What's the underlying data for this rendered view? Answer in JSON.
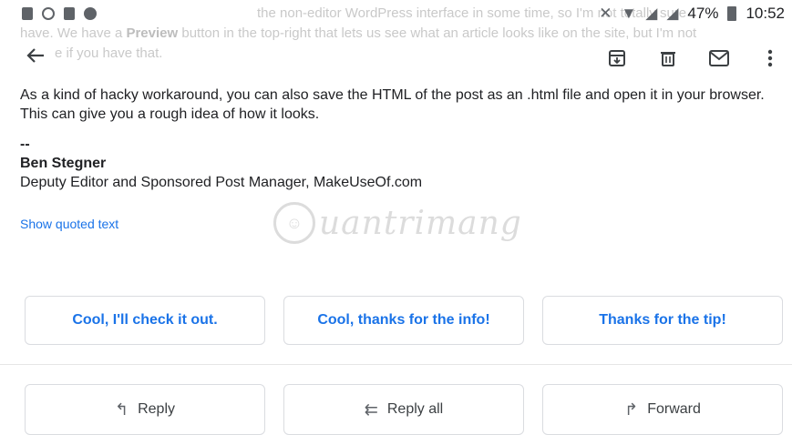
{
  "ghost": {
    "line1": "the non-editor WordPress interface in some time, so I'm not totally sure",
    "line2_pre": "have. We have a ",
    "line2_bold": "Preview",
    "line2_post": " button in the top-right that lets us see what an article looks like on the site, but I'm not",
    "line3": "e if you have that."
  },
  "status_bar": {
    "battery": "47%",
    "time": "10:52"
  },
  "message": {
    "body": "As a kind of hacky workaround, you can also save the HTML of the post as an .html file and open it in your browser. This can give you a rough idea of how it looks.",
    "sig_dashes": "--",
    "sig_name": "Ben Stegner",
    "sig_title": "Deputy Editor and Sponsored Post Manager, MakeUseOf.com",
    "show_quoted": "Show quoted text"
  },
  "watermark": {
    "text": "uantrimang"
  },
  "smart_replies": [
    "Cool, I'll check it out.",
    "Cool, thanks for the info!",
    "Thanks for the tip!"
  ],
  "actions": {
    "reply": "Reply",
    "reply_all": "Reply all",
    "forward": "Forward"
  },
  "colors": {
    "link": "#1a73e8",
    "border": "#dadce0"
  }
}
